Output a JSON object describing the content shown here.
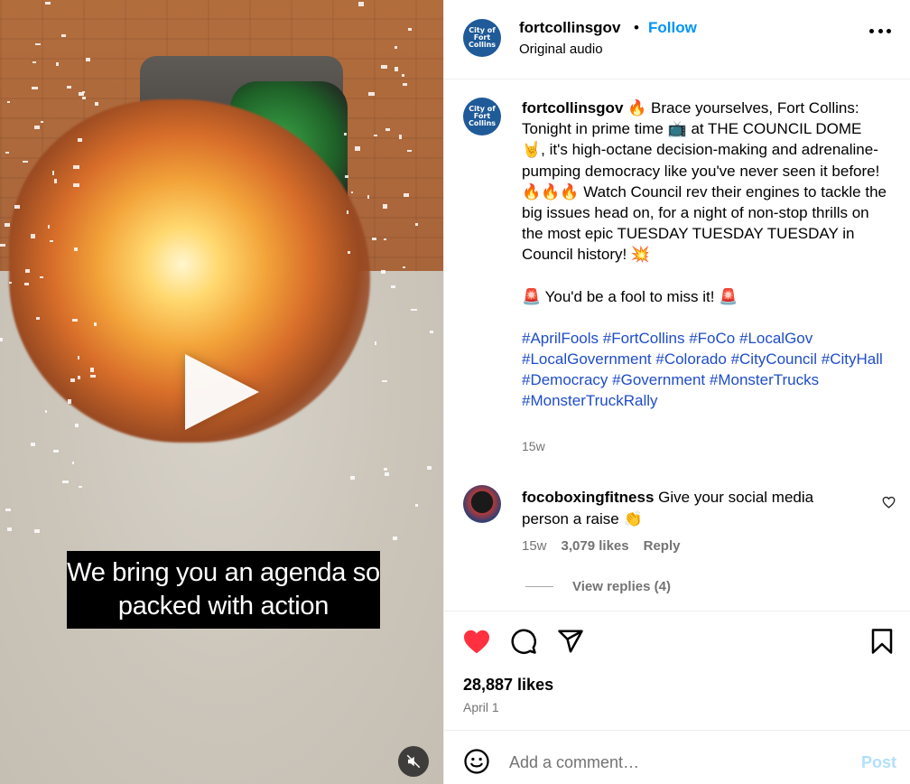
{
  "video": {
    "caption_line1": "We bring you an agenda so",
    "caption_line2": "packed with action"
  },
  "header": {
    "username": "fortcollinsgov",
    "separator": "•",
    "follow_label": "Follow",
    "audio": "Original audio"
  },
  "post_caption": {
    "username": "fortcollinsgov",
    "text1": "🔥 Brace yourselves, Fort Collins: Tonight in prime time 📺 at THE COUNCIL DOME 🤘, it's high-octane decision-making and adrenaline-pumping democracy like you've never seen it before! 🔥🔥🔥 Watch Council rev their engines to tackle the big issues head on, for a night of non-stop thrills on the most epic TUESDAY TUESDAY TUESDAY in Council history! 💥",
    "text2": "🚨 You'd be a fool to miss it! 🚨",
    "hashtags": [
      "#AprilFools",
      "#FortCollins",
      "#FoCo",
      "#LocalGov",
      "#LocalGovernment",
      "#Colorado",
      "#CityCouncil",
      "#CityHall",
      "#Democracy",
      "#Government",
      "#MonsterTrucks",
      "#MonsterTruckRally"
    ],
    "age": "15w"
  },
  "comment": {
    "username": "focoboxingfitness",
    "text": "Give your social media person a raise 👏",
    "age": "15w",
    "likes": "3,079 likes",
    "reply_label": "Reply",
    "view_replies": "View replies (4)"
  },
  "actions": {
    "likes": "28,887 likes",
    "date": "April 1"
  },
  "add_comment": {
    "placeholder": "Add a comment…",
    "post_label": "Post"
  },
  "avatar_logo": {
    "line1": "City of",
    "line2": "Fort Collins"
  },
  "colors": {
    "follow": "#0095f6",
    "liked_heart": "#ff3040",
    "hashtag": "#1f4dc9",
    "post_disabled": "#b2dffc"
  }
}
